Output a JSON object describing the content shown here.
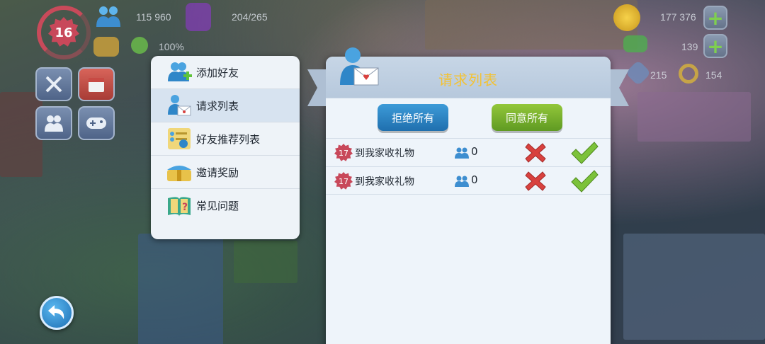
{
  "hud": {
    "level": "16",
    "population": "115 960",
    "storage": "204/265",
    "happiness": "100%",
    "simoleons": "177 376",
    "simcash": "139",
    "keys_a": "215",
    "keys_b": "154"
  },
  "menu": {
    "items": [
      {
        "label": "添加好友",
        "icon": "add-friend-icon"
      },
      {
        "label": "请求列表",
        "icon": "request-list-icon"
      },
      {
        "label": "好友推荐列表",
        "icon": "recommend-list-icon"
      },
      {
        "label": "邀请奖励",
        "icon": "invite-reward-icon"
      },
      {
        "label": "常见问题",
        "icon": "faq-icon"
      }
    ],
    "active_index": 1
  },
  "panel": {
    "title": "请求列表",
    "reject_all_label": "拒绝所有",
    "accept_all_label": "同意所有",
    "requests": [
      {
        "level": "17",
        "name": "到我家收礼物",
        "friends": "0"
      },
      {
        "level": "17",
        "name": "到我家收礼物",
        "friends": "0"
      }
    ]
  },
  "colors": {
    "title_gold": "#f3c233",
    "reject_blue": "#1f6fae",
    "accept_green": "#5f9a22",
    "level_red": "#c8485a"
  }
}
